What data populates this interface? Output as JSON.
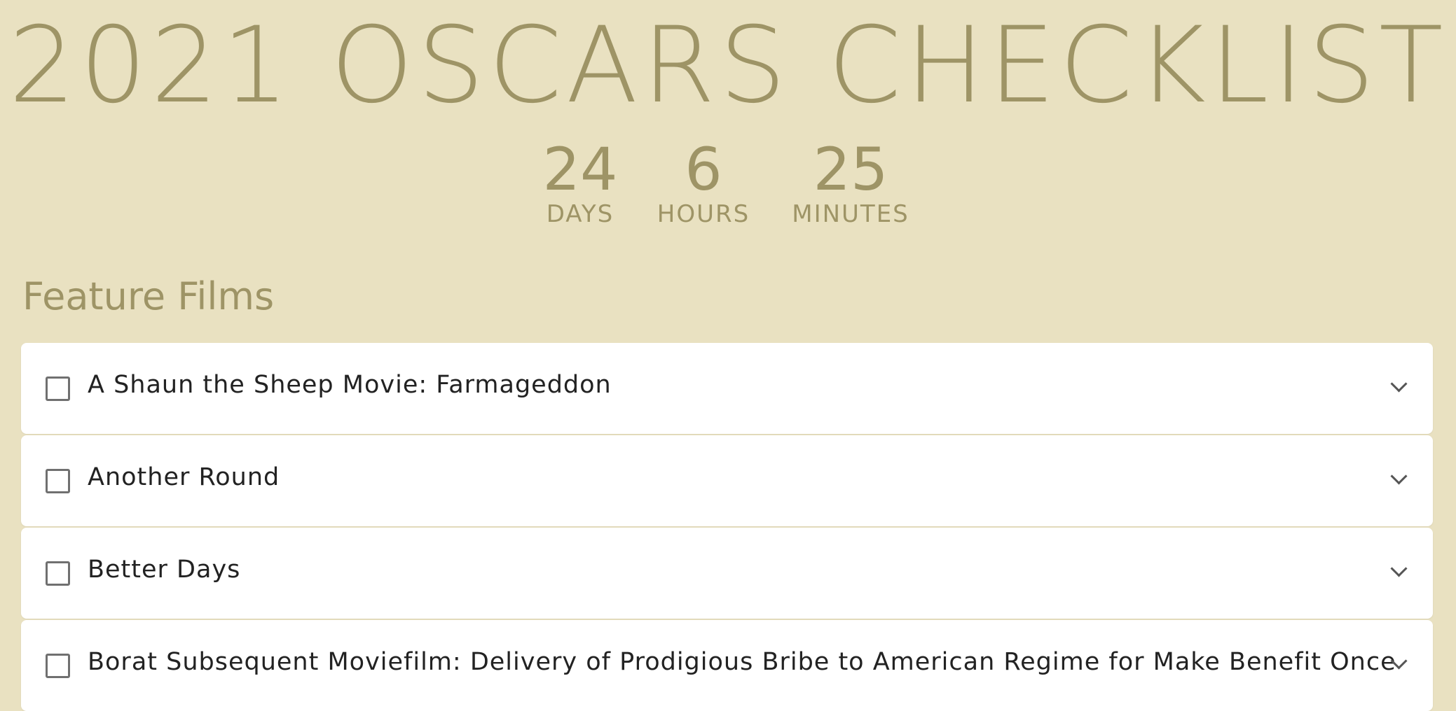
{
  "title": "2021 OSCARS CHECKLIST",
  "countdown": {
    "days": {
      "value": "24",
      "label": "DAYS"
    },
    "hours": {
      "value": "6",
      "label": "HOURS"
    },
    "minutes": {
      "value": "25",
      "label": "MINUTES"
    }
  },
  "section": {
    "title": "Feature Films"
  },
  "films": [
    {
      "name": "A Shaun the Sheep Movie: Farmageddon",
      "checked": false
    },
    {
      "name": "Another Round",
      "checked": false
    },
    {
      "name": "Better Days",
      "checked": false
    },
    {
      "name": "Borat Subsequent Moviefilm: Delivery of Prodigious Bribe to American Regime for Make Benefit Once",
      "checked": false
    }
  ],
  "colors": {
    "background": "#e9e1c1",
    "accent": "#9e9466",
    "card": "#ffffff"
  }
}
